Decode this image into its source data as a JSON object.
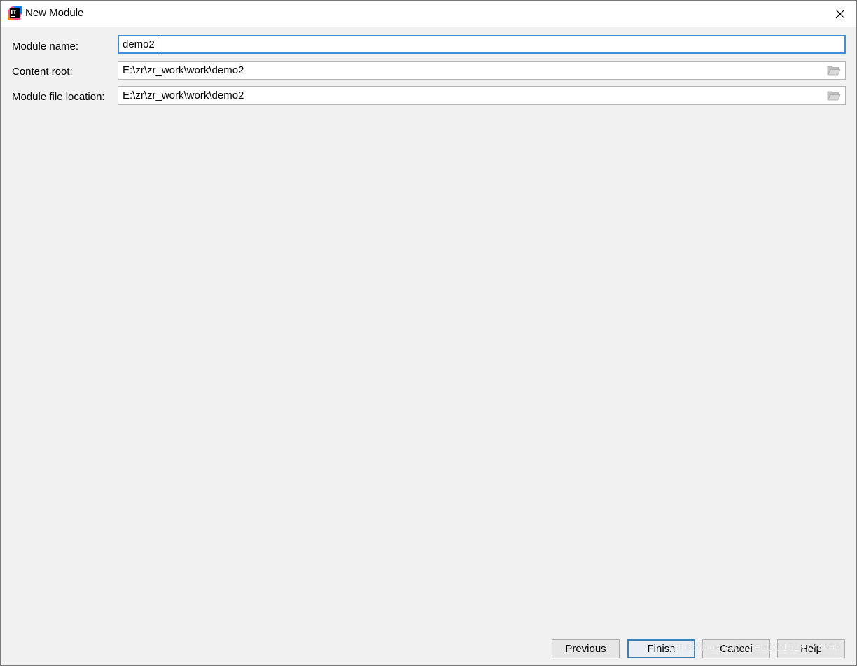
{
  "window": {
    "title": "New Module",
    "icon": "intellij-idea-icon",
    "close_icon": "close-icon"
  },
  "form": {
    "module_name": {
      "label": "Module name:",
      "value": "demo2"
    },
    "content_root": {
      "label": "Content root:",
      "value": "E:\\zr\\zr_work\\work\\demo2",
      "browse_icon": "folder-open-icon"
    },
    "module_file_location": {
      "label": "Module file location:",
      "value": "E:\\zr\\zr_work\\work\\demo2",
      "browse_icon": "folder-open-icon"
    }
  },
  "buttons": {
    "previous": {
      "mnemonic": "P",
      "rest": "revious"
    },
    "finish": {
      "mnemonic": "F",
      "rest": "inish"
    },
    "cancel": {
      "label": "Cancel"
    },
    "help": {
      "label": "Help"
    }
  },
  "watermark": "https://blog.csdn.net/CQ1524778653",
  "colors": {
    "focus_border": "#3d90d5",
    "default_button_border": "#3c7fb1",
    "dialog_bg": "#f1f1f1"
  }
}
